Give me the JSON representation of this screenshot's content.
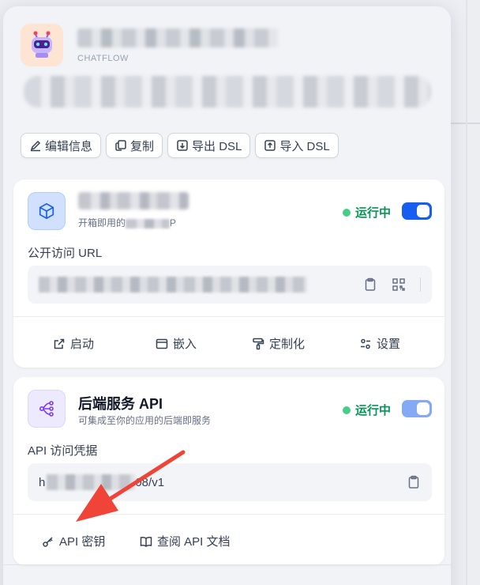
{
  "app": {
    "mode": "CHATFLOW"
  },
  "actions": [
    {
      "label": "编辑信息",
      "icon": "pencil-icon"
    },
    {
      "label": "复制",
      "icon": "copy-icon"
    },
    {
      "label": "导出 DSL",
      "icon": "export-icon"
    },
    {
      "label": "导入 DSL",
      "icon": "import-icon"
    }
  ],
  "webapp": {
    "subtitle_visible": "开箱即用的",
    "subtitle_end": "P",
    "status": "运行中",
    "url_label": "公开访问 URL",
    "actions": [
      {
        "label": "启动",
        "icon": "external-link-icon"
      },
      {
        "label": "嵌入",
        "icon": "window-icon"
      },
      {
        "label": "定制化",
        "icon": "paint-roller-icon"
      },
      {
        "label": "设置",
        "icon": "settings-icon"
      }
    ]
  },
  "backend_api": {
    "title": "后端服务 API",
    "subtitle": "可集成至你的应用的后端即服务",
    "status": "运行中",
    "credential_label": "API 访问凭据",
    "credential_start": "h",
    "credential_end": "08/v1",
    "actions": [
      {
        "label": "API 密钥",
        "icon": "key-icon"
      },
      {
        "label": "查阅 API 文档",
        "icon": "book-icon"
      }
    ]
  },
  "colors": {
    "status_green": "#079455",
    "toggle_blue": "#155eef",
    "arrow_red": "#f04438"
  }
}
